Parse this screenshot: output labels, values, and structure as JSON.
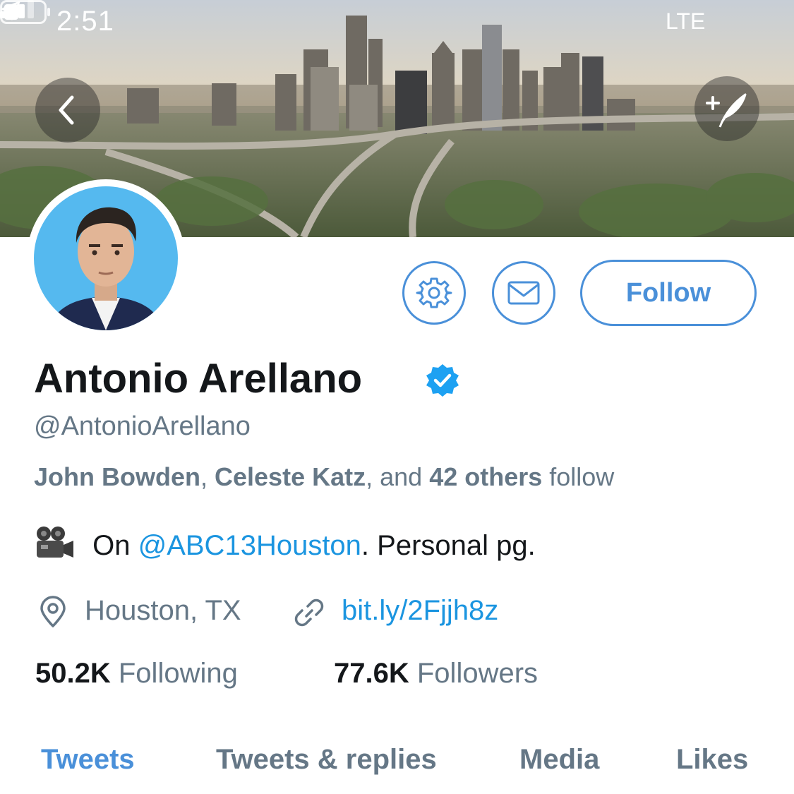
{
  "status_bar": {
    "time": "2:51",
    "network": "LTE",
    "icons": [
      "location-arrow-icon",
      "signal-icon",
      "battery-icon"
    ]
  },
  "banner": {
    "description_icon": "city-skyline-photo",
    "back_icon": "chevron-left-icon",
    "compose_icon": "compose-tweet-icon"
  },
  "profile": {
    "name": "Antonio Arellano",
    "verified": true,
    "handle": "@AntonioArellano",
    "followed_by": {
      "names": [
        "John Bowden",
        "Celeste Katz"
      ],
      "separator": ", ",
      "and_text": ", and ",
      "others_count": "42 others",
      "suffix": " follow"
    },
    "bio": {
      "prefix": " On ",
      "mention": "@ABC13Houston",
      "suffix": ". Personal pg.",
      "emoji_icon": "movie-camera-icon"
    },
    "location": "Houston, TX",
    "link": "bit.ly/2Fjjh8z",
    "following_count": "50.2K",
    "following_label": "Following",
    "followers_count": "77.6K",
    "followers_label": "Followers"
  },
  "actions": {
    "follow_label": "Follow",
    "settings_icon": "gear-icon",
    "message_icon": "envelope-icon"
  },
  "tabs": [
    {
      "label": "Tweets",
      "active": true
    },
    {
      "label": "Tweets & replies",
      "active": false
    },
    {
      "label": "Media",
      "active": false
    },
    {
      "label": "Likes",
      "active": false
    }
  ],
  "colors": {
    "accent": "#4a90d9",
    "link": "#1b95e0",
    "secondary_text": "#657786",
    "primary_text": "#14171a",
    "avatar_bg": "#55b9ef"
  }
}
